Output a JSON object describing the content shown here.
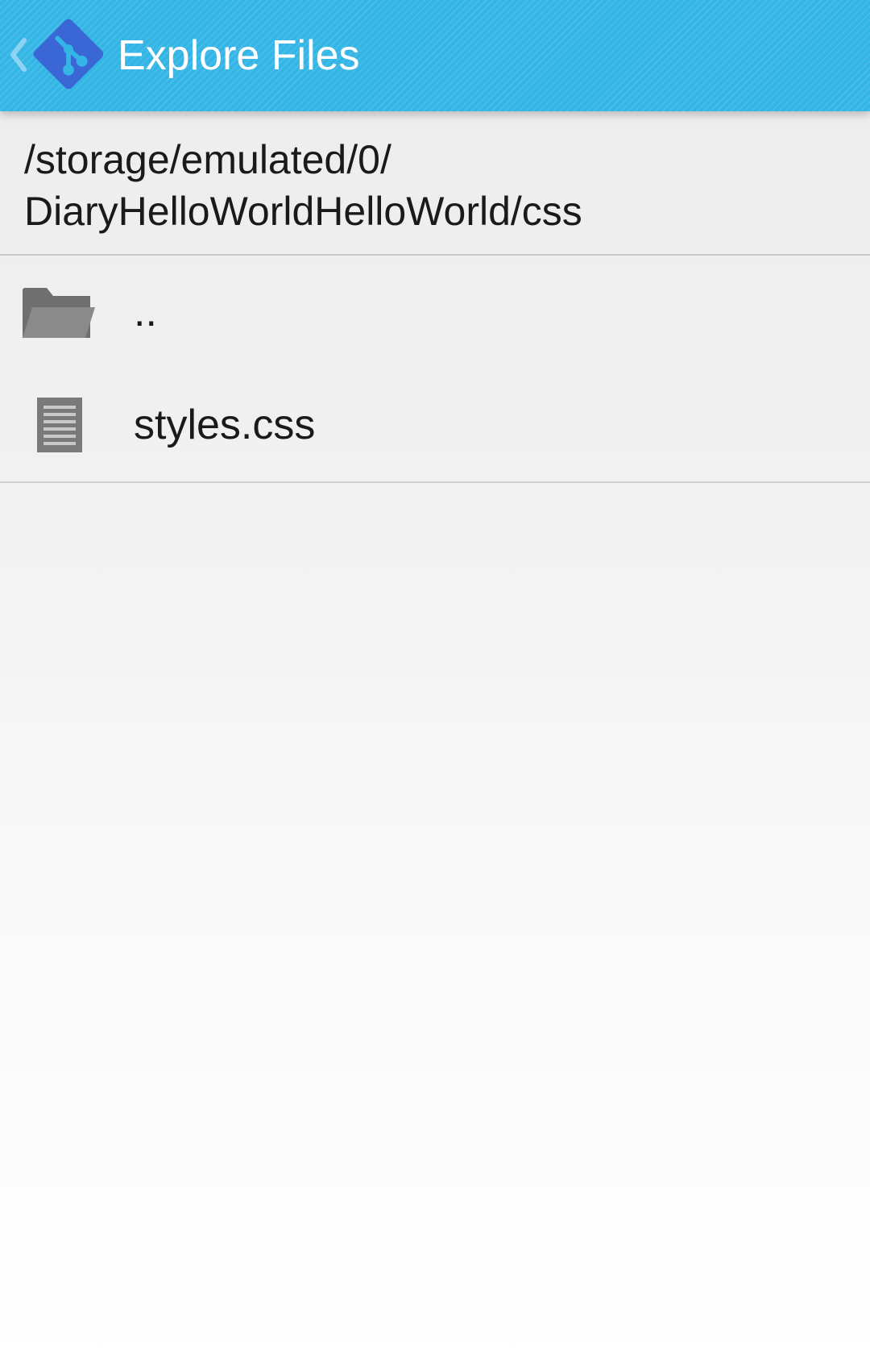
{
  "app_bar": {
    "title": "Explore Files",
    "background_color": "#33b5e5",
    "logo_color": "#3b67d6",
    "up_icon": "chevron-left-icon",
    "logo_icon": "git-logo-icon"
  },
  "path": {
    "line1": "/storage/emulated/0/",
    "line2": "DiaryHelloWorldHelloWorld/css"
  },
  "files": [
    {
      "name": "..",
      "icon": "folder-icon"
    },
    {
      "name": "styles.css",
      "icon": "file-icon"
    }
  ]
}
